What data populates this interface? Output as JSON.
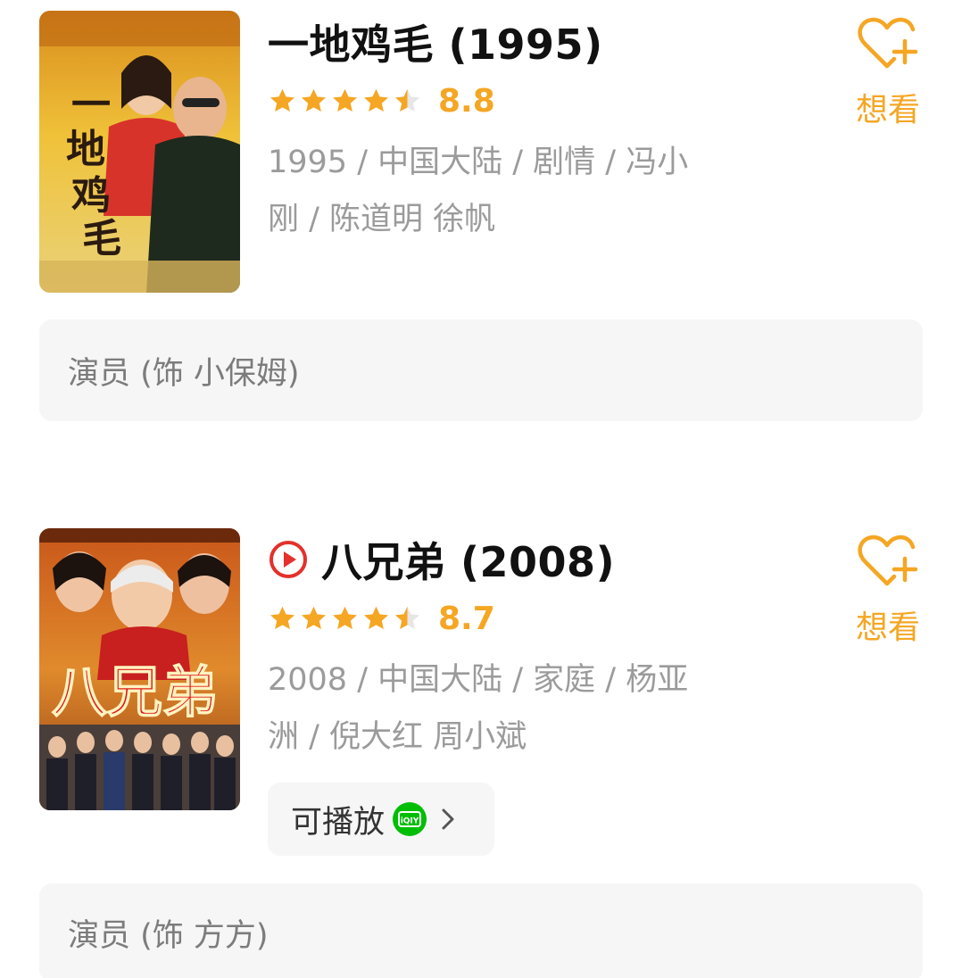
{
  "colors": {
    "accent": "#f5a623",
    "play_red": "#e4312b",
    "iqiyi_green": "#00be06"
  },
  "movies": [
    {
      "title": "一地鸡毛 (1995)",
      "rating_stars": 4.5,
      "score": "8.8",
      "meta_line1": "1995 / 中国大陆 / 剧情 / 冯小",
      "meta_line2": "刚 / 陈道明 徐帆",
      "want_label": "想看",
      "role": "演员 (饰 小保姆)",
      "poster_title": "一地鸡毛"
    },
    {
      "title": "八兄弟 (2008)",
      "playable_icon": "play-circle-icon",
      "rating_stars": 4.5,
      "score": "8.7",
      "meta_line1": "2008 / 中国大陆 / 家庭 / 杨亚",
      "meta_line2": "洲 / 倪大红 周小斌",
      "want_label": "想看",
      "play_chip_label": "可播放",
      "play_chip_icon": "iqiyi-icon",
      "role": "演员 (饰 方方)",
      "poster_title": "八兄弟"
    }
  ]
}
